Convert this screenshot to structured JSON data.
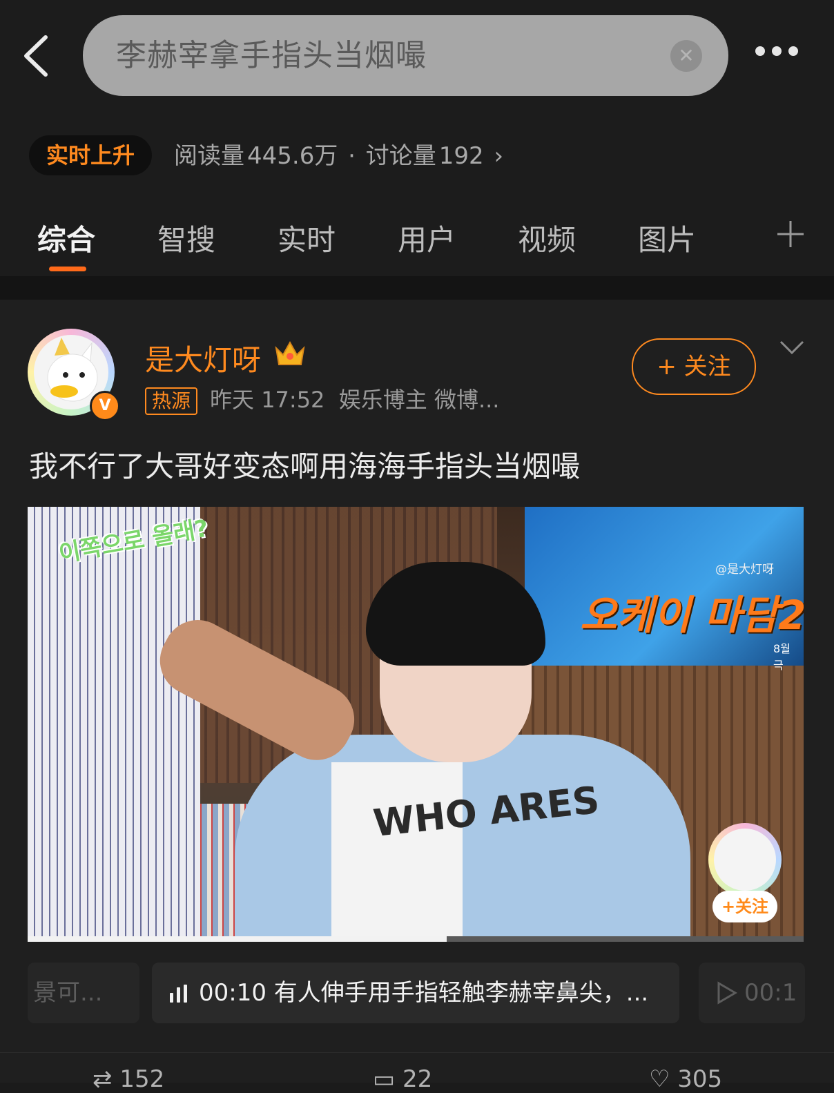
{
  "search": {
    "query": "李赫宰拿手指头当烟嘬"
  },
  "topic": {
    "badge": "实时上升",
    "reads_label": "阅读量",
    "reads": "445.6万",
    "sep": "·",
    "discuss_label": "讨论量",
    "discuss": "192",
    "arrow": "›"
  },
  "tabs": [
    {
      "label": "综合",
      "active": true
    },
    {
      "label": "智搜"
    },
    {
      "label": "实时"
    },
    {
      "label": "用户"
    },
    {
      "label": "视频"
    },
    {
      "label": "图片"
    }
  ],
  "post": {
    "author": "是大灯呀",
    "verified_mark": "V",
    "hot_tag": "热源",
    "time": "昨天 17:52",
    "source": "娱乐博主 微博...",
    "follow_label": "+ 关注",
    "text": "我不行了大哥好变态啊用海海手指头当烟嘬",
    "video": {
      "sticker": "이쪽으로 올래?",
      "poster_title": "오케이 마담2",
      "poster_sub": "8월 극",
      "watermark": "@是大灯呀",
      "tee_text": "WHO ARES",
      "follow_overlay": "+关注",
      "progress": 0.54
    },
    "chips": {
      "left": "景可...",
      "mid": "00:10 有人伸手用手指轻触李赫宰鼻尖，...",
      "right": "00:1"
    },
    "actions": [
      "152",
      "22",
      "305"
    ]
  },
  "colors": {
    "accent": "#ff8a1f",
    "background": "#1b1b1b"
  }
}
